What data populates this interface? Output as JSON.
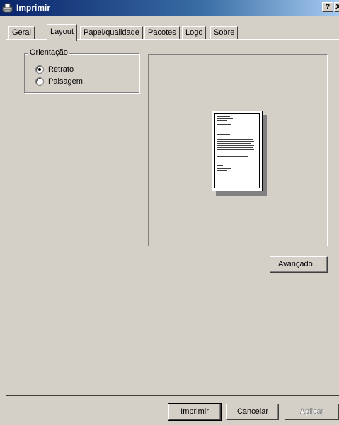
{
  "window": {
    "title": "Imprimir",
    "help_label": "?",
    "close_label": "X"
  },
  "tabs": [
    {
      "label": "Geral"
    },
    {
      "label": "Layout"
    },
    {
      "label": "Papel/qualidade"
    },
    {
      "label": "Pacotes"
    },
    {
      "label": "Logo"
    },
    {
      "label": "Sobre"
    }
  ],
  "active_tab": "Layout",
  "orientation": {
    "legend": "Orientação",
    "options": [
      {
        "label": "Retrato",
        "checked": true
      },
      {
        "label": "Paisagem",
        "checked": false
      }
    ]
  },
  "preview": {
    "orientation": "portrait"
  },
  "buttons": {
    "advanced": "Avançado...",
    "print": "Imprimir",
    "cancel": "Cancelar",
    "apply": "Aplicar"
  }
}
